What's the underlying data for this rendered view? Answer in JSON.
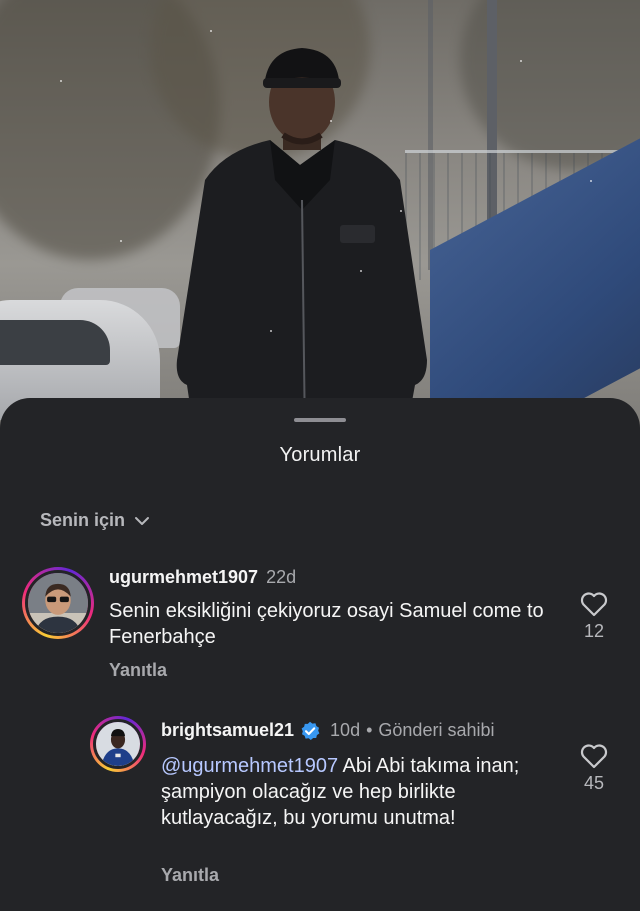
{
  "sheet": {
    "title": "Yorumlar",
    "filter_label": "Senin için"
  },
  "comments": [
    {
      "username": "ugurmehmet1907",
      "time": "22d",
      "text": "Senin eksikliğini çekiyoruz osayi Samuel come to Fenerbahçe",
      "reply_label": "Yanıtla",
      "likes": "12"
    },
    {
      "username": "brightsamuel21",
      "verified": true,
      "time": "10d",
      "author_tag": "Gönderi sahibi",
      "mention": "@ugurmehmet1907",
      "text": " Abi Abi takıma inan; şampiyon olacağız ve hep birlikte kutlayacağız, bu yorumu unutma!",
      "reply_label": "Yanıtla",
      "likes": "45"
    }
  ],
  "colors": {
    "sheet_bg": "#232427",
    "mention": "#b7c8ff",
    "verified": "#3897f0"
  }
}
